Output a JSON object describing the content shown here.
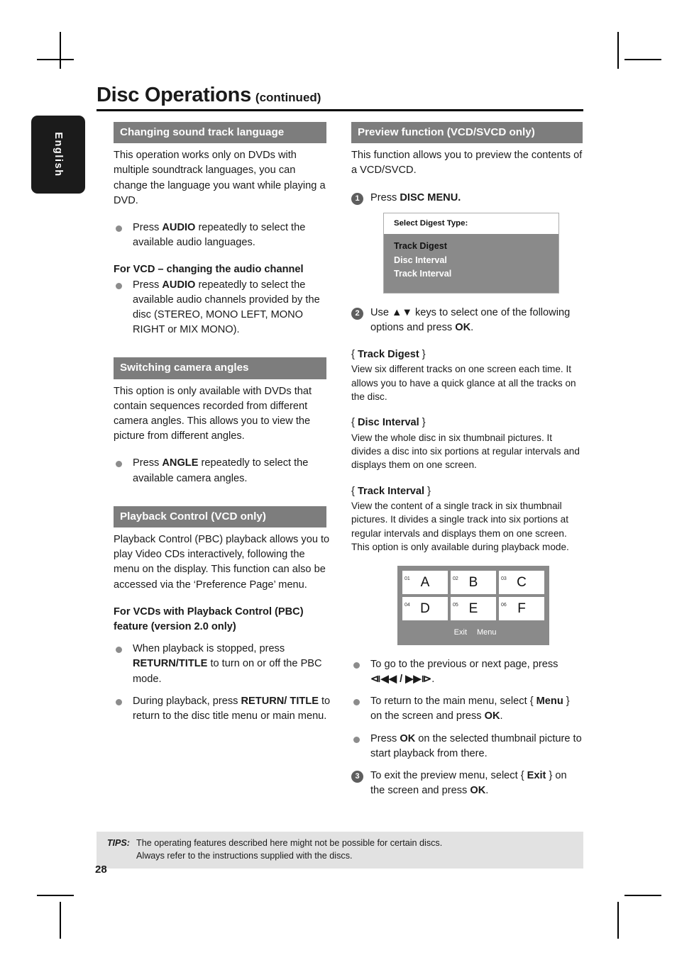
{
  "language_tab": "English",
  "title": {
    "main": "Disc Operations",
    "sub": "(continued)"
  },
  "left_column": {
    "section1": {
      "heading": "Changing sound track language",
      "intro": "This operation works only on DVDs with multiple soundtrack languages, you can change the language you want while playing a DVD.",
      "bullet1_pre": "Press ",
      "bullet1_bold": "AUDIO",
      "bullet1_post": " repeatedly to select the available audio languages.",
      "subheading": "For VCD – changing the audio channel",
      "bullet2_pre": "Press ",
      "bullet2_bold": "AUDIO",
      "bullet2_post": " repeatedly to select the available audio channels provided by the disc (STEREO, MONO LEFT, MONO RIGHT or MIX MONO)."
    },
    "section2": {
      "heading": "Switching camera angles",
      "intro": "This option is only available with DVDs that contain sequences recorded from different camera angles. This allows you to view the picture from different angles.",
      "bullet1_pre": "Press ",
      "bullet1_bold": "ANGLE",
      "bullet1_post": " repeatedly to select the available camera angles."
    },
    "section3": {
      "heading": "Playback Control (VCD only)",
      "intro": "Playback Control (PBC) playback allows you to play Video CDs interactively, following the menu on the display.  This function can also be accessed via the ‘Preference Page’ menu.",
      "subheading": "For VCDs with Playback Control (PBC) feature (version 2.0 only)",
      "bullet1_pre": "When playback is stopped, press ",
      "bullet1_bold": "RETURN/TITLE",
      "bullet1_post": " to turn on or off the PBC mode.",
      "bullet2_pre": "During playback, press ",
      "bullet2_bold": "RETURN/ TITLE",
      "bullet2_post": " to return to the disc title menu or main menu."
    }
  },
  "right_column": {
    "heading": "Preview function (VCD/SVCD only)",
    "intro": "This function allows you to preview the contents of a VCD/SVCD.",
    "step1": {
      "num": "1",
      "pre": "Press ",
      "bold": "DISC MENU."
    },
    "digest_box": {
      "title": "Select Digest Type:",
      "items": [
        {
          "label": "Track Digest",
          "selected": true
        },
        {
          "label": "Disc Interval",
          "selected": false
        },
        {
          "label": "Track Interval",
          "selected": false
        }
      ]
    },
    "step2": {
      "num": "2",
      "pre": "Use ",
      "keys": "▲▼",
      "mid": " keys to select one of the following options and press ",
      "bold": "OK",
      "post": "."
    },
    "options": [
      {
        "brace_open": "{ ",
        "name": "Track Digest",
        "brace_close": " }",
        "body": "View six different tracks on one screen each time.  It allows you to have a quick glance at all the tracks on the disc."
      },
      {
        "brace_open": "{ ",
        "name": "Disc Interval",
        "brace_close": " }",
        "body": "View the whole disc in six thumbnail pictures. It divides a disc into six portions at regular intervals and displays them on one screen."
      },
      {
        "brace_open": "{ ",
        "name": "Track Interval",
        "brace_close": " }",
        "body": "View the content of a single track in six thumbnail pictures.  It divides a single track into six portions at regular intervals and displays them on one screen. This option is only available during playback mode."
      }
    ],
    "thumb_grid": {
      "cells": [
        {
          "index": "01",
          "letter": "A"
        },
        {
          "index": "02",
          "letter": "B"
        },
        {
          "index": "03",
          "letter": "C"
        },
        {
          "index": "04",
          "letter": "D"
        },
        {
          "index": "05",
          "letter": "E"
        },
        {
          "index": "06",
          "letter": "F"
        }
      ],
      "exit_label": "Exit",
      "menu_label": "Menu"
    },
    "bullets": [
      {
        "pre": "To go to the previous or next page, press ",
        "symbols": "⧏◀◀ / ▶▶⧐",
        "post": "."
      }
    ],
    "bullet_menu": {
      "pre": "To return to the main menu, select { ",
      "bold": "Menu",
      "mid": " } on the screen and press ",
      "bold2": "OK",
      "post": "."
    },
    "bullet_ok": {
      "pre": "Press ",
      "bold": "OK",
      "post": " on the selected thumbnail picture to start playback from there."
    },
    "step3": {
      "num": "3",
      "pre": "To exit the preview menu, select { ",
      "bold": "Exit",
      "mid": " } on the screen and press ",
      "bold2": "OK",
      "post": "."
    }
  },
  "tips": {
    "label": "TIPS:",
    "line1": "The operating features described here might not be possible for certain discs.",
    "line2": "Always refer to the instructions supplied with the discs."
  },
  "page_number": "28"
}
